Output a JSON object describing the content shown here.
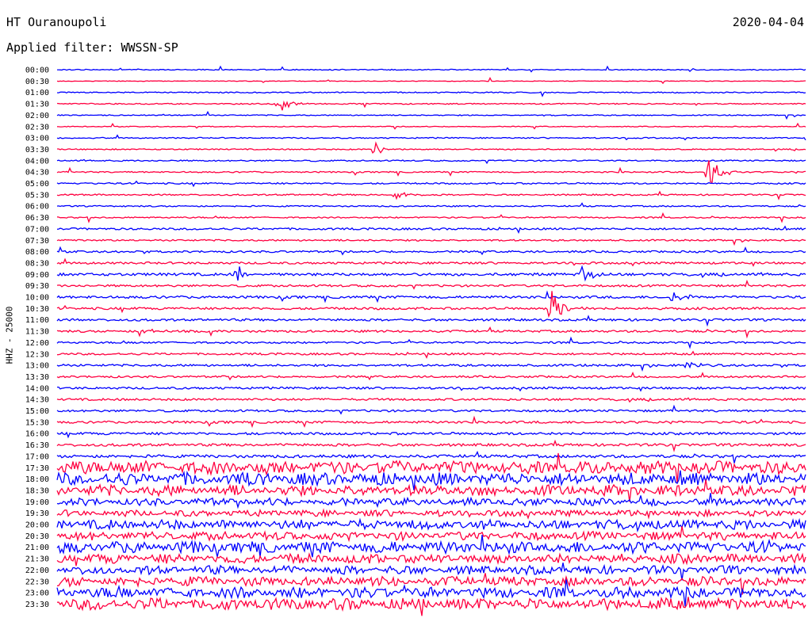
{
  "header": {
    "station": "HT Ouranoupoli",
    "date": "2020-04-04",
    "filter": "Applied filter: WWSSN-SP",
    "channel_label": "HHZ - 25000"
  },
  "chart_data": {
    "type": "line",
    "chart_subtype": "helicorder",
    "colors": {
      "blue": "#0000ff",
      "red": "#ff0040"
    },
    "color_cycle": [
      "blue",
      "red"
    ],
    "row_labels": [
      "00:00",
      "00:30",
      "01:00",
      "01:30",
      "02:00",
      "02:30",
      "03:00",
      "03:30",
      "04:00",
      "04:30",
      "05:00",
      "05:30",
      "06:00",
      "06:30",
      "07:00",
      "07:30",
      "08:00",
      "08:30",
      "09:00",
      "09:30",
      "10:00",
      "10:30",
      "11:00",
      "11:30",
      "12:00",
      "12:30",
      "13:00",
      "13:30",
      "14:00",
      "14:30",
      "15:00",
      "15:30",
      "16:00",
      "16:30",
      "17:00",
      "17:30",
      "18:00",
      "18:30",
      "19:00",
      "19:30",
      "20:00",
      "20:30",
      "21:00",
      "21:30",
      "22:00",
      "22:30",
      "23:00",
      "23:30"
    ],
    "noise_level": [
      0.6,
      0.4,
      0.7,
      0.7,
      0.6,
      0.5,
      0.7,
      0.7,
      0.8,
      0.8,
      0.9,
      0.9,
      0.8,
      0.8,
      1.2,
      1.0,
      1.2,
      1.3,
      1.6,
      1.3,
      1.5,
      1.4,
      1.4,
      1.3,
      1.1,
      1.2,
      1.3,
      1.2,
      1.3,
      1.3,
      1.3,
      1.4,
      1.5,
      1.6,
      1.8,
      6.0,
      6.0,
      5.0,
      3.5,
      3.0,
      4.5,
      4.0,
      5.5,
      4.5,
      4.0,
      4.5,
      5.0,
      5.5
    ],
    "events": [
      {
        "row": 3,
        "x": 0.3,
        "amp": 9
      },
      {
        "row": 7,
        "x": 0.42,
        "amp": 14
      },
      {
        "row": 9,
        "x": 0.87,
        "amp": 28
      },
      {
        "row": 11,
        "x": 0.45,
        "amp": 7
      },
      {
        "row": 18,
        "x": 0.24,
        "amp": 13
      },
      {
        "row": 18,
        "x": 0.7,
        "amp": 13
      },
      {
        "row": 20,
        "x": 0.82,
        "amp": 12
      },
      {
        "row": 21,
        "x": 0.66,
        "amp": 30
      },
      {
        "row": 23,
        "x": 0.11,
        "amp": 7
      },
      {
        "row": 26,
        "x": 0.84,
        "amp": 6
      }
    ]
  }
}
